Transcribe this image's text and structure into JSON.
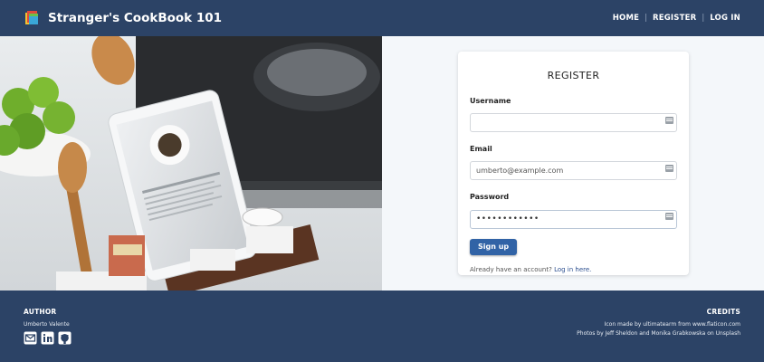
{
  "header": {
    "brand": "Stranger's CookBook 101",
    "nav": [
      "HOME",
      "REGISTER",
      "LOG IN"
    ]
  },
  "form": {
    "title": "REGISTER",
    "username_label": "Username",
    "username_value": "",
    "email_label": "Email",
    "email_placeholder": "umberto@example.com",
    "password_label": "Password",
    "password_value": "••••••••••••",
    "submit": "Sign up",
    "account_prompt": "Already have an account?",
    "login_link": "Log in here."
  },
  "footer": {
    "author_heading": "AUTHOR",
    "author_name": "Umberto Valente",
    "social_icons": [
      "envelope-icon",
      "linkedin-icon",
      "github-icon"
    ],
    "credits_heading": "CREDITS",
    "credit_line1": "Icon made by ultimatearm from www.flaticon.com",
    "credit_line2": "Photos by Jeff Sheldon and Monika Grabkowska on Unsplash"
  },
  "colors": {
    "navy": "#2c4366",
    "button": "#3163a6",
    "page_bg": "#f4f7fa"
  }
}
